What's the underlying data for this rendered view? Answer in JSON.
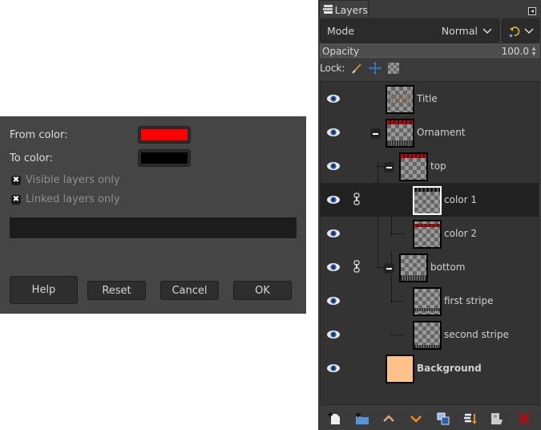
{
  "dialog": {
    "from_color_label": "From color:",
    "from_color": "#ff0000",
    "to_color_label": "To color:",
    "to_color": "#000000",
    "visible_layers_only": {
      "label": "Visible layers only",
      "checked": true
    },
    "linked_layers_only": {
      "label": "Linked layers only",
      "checked": true
    },
    "check_glyph": "✖",
    "buttons": {
      "help": "Help",
      "reset": "Reset",
      "cancel": "Cancel",
      "ok": "OK"
    }
  },
  "layers_panel": {
    "tab_label": "Layers",
    "mode_label": "Mode",
    "mode_value": "Normal",
    "chevron": "⌵",
    "opacity_label": "Opacity",
    "opacity_value": "100.0",
    "lock_label": "Lock:",
    "layers": [
      {
        "name": "Title",
        "visible": true,
        "linked": false,
        "depth": 0
      },
      {
        "name": "Ornament",
        "visible": true,
        "linked": false,
        "depth": 0,
        "group": true,
        "expanded": true
      },
      {
        "name": "top",
        "visible": true,
        "linked": false,
        "depth": 1,
        "group": true,
        "expanded": true
      },
      {
        "name": "color 1",
        "visible": true,
        "linked": true,
        "depth": 2,
        "selected": true
      },
      {
        "name": "color 2",
        "visible": true,
        "linked": false,
        "depth": 2
      },
      {
        "name": "bottom",
        "visible": true,
        "linked": true,
        "depth": 1,
        "group": true,
        "expanded": true
      },
      {
        "name": "first stripe",
        "visible": true,
        "linked": false,
        "depth": 2
      },
      {
        "name": "second stripe",
        "visible": true,
        "linked": false,
        "depth": 2
      },
      {
        "name": "Background",
        "visible": true,
        "linked": false,
        "depth": 0,
        "color": "#ffc18a"
      }
    ],
    "toolbar": [
      "new-layer",
      "new-layer-group",
      "raise-layer",
      "lower-layer",
      "duplicate-layer",
      "merge-down",
      "mask-layer",
      "delete-layer"
    ]
  }
}
